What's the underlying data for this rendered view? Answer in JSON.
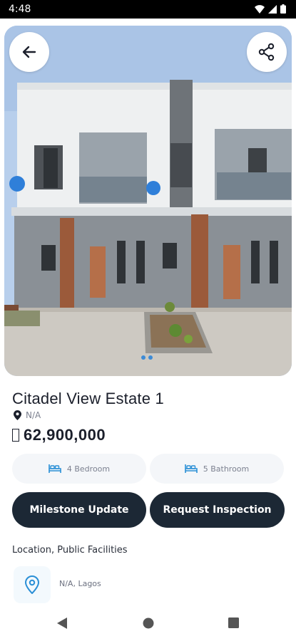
{
  "status_bar": {
    "time": "4:48"
  },
  "hero": {
    "back_icon": "arrow-left-icon",
    "share_icon": "share-icon",
    "carousel_pages": 2
  },
  "property": {
    "title": "Citadel View Estate 1",
    "location": "N/A",
    "currency_symbol": "",
    "price": "62,900,000"
  },
  "features": {
    "bedrooms": "4 Bedroom",
    "bathrooms": "5 Bathroom"
  },
  "actions": {
    "milestone": "Milestone Update",
    "inspection": "Request Inspection"
  },
  "section": {
    "title": "Location, Public Facilities",
    "address": "N/A, Lagos"
  },
  "colors": {
    "primary_dark": "#1c2835",
    "accent_blue": "#2a8fd6",
    "chip_bg": "#f4f6f9"
  }
}
